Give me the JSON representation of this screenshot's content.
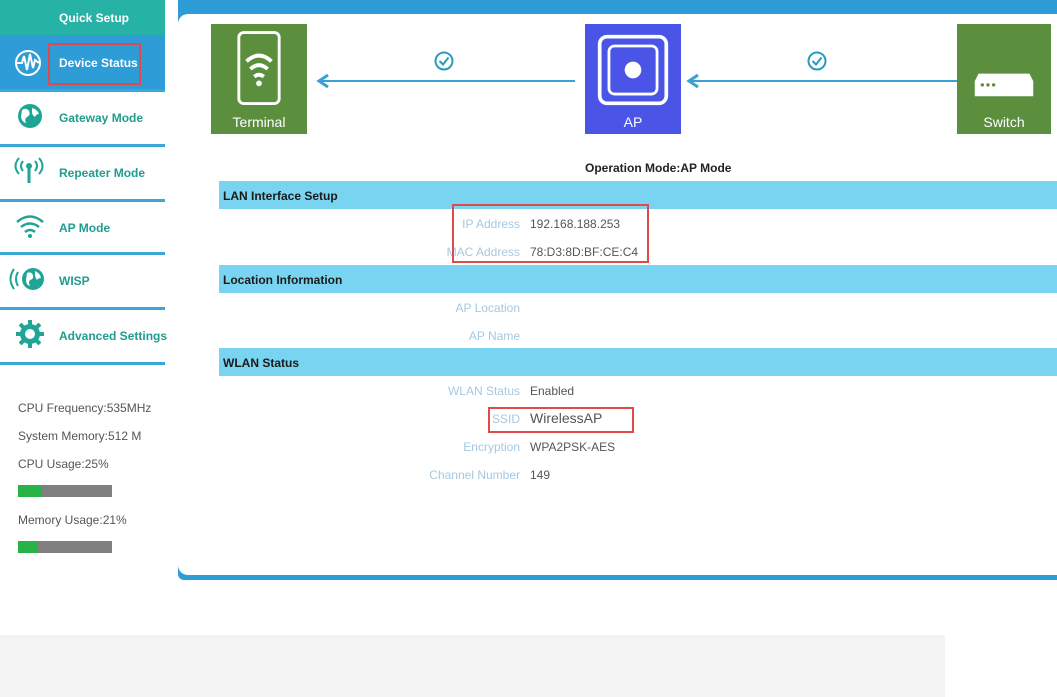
{
  "sidebar": {
    "quick_setup": "Quick Setup",
    "items": [
      {
        "label": "Device Status",
        "icon": "pulse-icon"
      },
      {
        "label": "Gateway Mode",
        "icon": "globe-icon"
      },
      {
        "label": "Repeater Mode",
        "icon": "antenna-icon"
      },
      {
        "label": "AP Mode",
        "icon": "wifi-icon"
      },
      {
        "label": "WISP",
        "icon": "globe-signal-icon"
      },
      {
        "label": "Advanced Settings",
        "icon": "gear-icon"
      }
    ],
    "stats": {
      "cpu_frequency": "CPU Frequency:535MHz",
      "system_memory": "System Memory:512 M",
      "cpu_usage": "CPU Usage:25%",
      "cpu_usage_level": 0.25,
      "memory_usage": "Memory Usage:21%",
      "memory_usage_level": 0.21
    }
  },
  "topology": {
    "terminal": "Terminal",
    "ap": "AP",
    "switch": "Switch"
  },
  "operation_mode": "Operation Mode:AP Mode",
  "lan": {
    "title": "LAN Interface Setup",
    "ip_label": "IP Address",
    "ip_value": "192.168.188.253",
    "mac_label": "MAC Address",
    "mac_value": "78:D3:8D:BF:CE:C4"
  },
  "location": {
    "title": "Location Information",
    "ap_location_label": "AP Location",
    "ap_name_label": "AP Name"
  },
  "wlan": {
    "title": "WLAN Status",
    "status_label": "WLAN Status",
    "status_value": "Enabled",
    "ssid_label": "SSID",
    "ssid_value": "WirelessAP",
    "encryption_label": "Encryption",
    "encryption_value": "WPA2PSK-AES",
    "channel_label": "Channel Number",
    "channel_value": "149"
  },
  "colors": {
    "accent_blue": "#2e9cd6",
    "teal": "#27b2a6",
    "section_blue": "#78d4f0",
    "highlight_red": "#e14a4a",
    "terminal_green": "#5b8f3e",
    "ap_blue": "#4a55e8"
  }
}
